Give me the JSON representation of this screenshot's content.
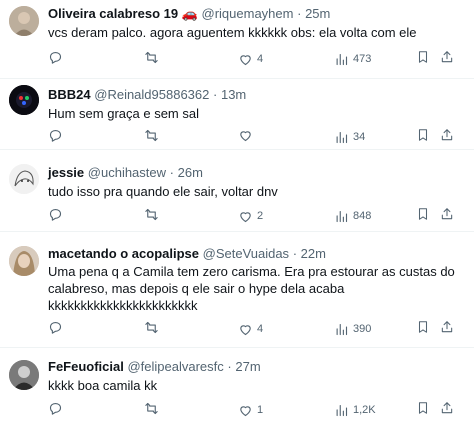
{
  "tweets": [
    {
      "name": "Oliveira calabreso 19 🚗",
      "handle": "@riquemayhem",
      "sep": "·",
      "time": "25m",
      "text": [
        "vcs deram palco. agora aguentem kkkkkk obs: ela volta com ele"
      ],
      "replies": "",
      "retweets": "",
      "likes": "4",
      "views": "473"
    },
    {
      "name": "BBB24",
      "handle": "@Reinald95886362",
      "sep": "·",
      "time": "13m",
      "text": [
        "Hum sem graça e sem sal"
      ],
      "replies": "",
      "retweets": "",
      "likes": "",
      "views": "34"
    },
    {
      "name": "jessie",
      "handle": "@uchihastew",
      "sep": "·",
      "time": "26m",
      "text": [
        "tudo isso pra quando ele sair, voltar dnv"
      ],
      "replies": "",
      "retweets": "",
      "likes": "2",
      "views": "848"
    },
    {
      "name": "macetando o acopalipse",
      "handle": "@SeteVuaidas",
      "sep": "·",
      "time": "22m",
      "text": [
        "Uma pena q a Camila tem zero carisma. Era pra estourar as custas do",
        "calabreso, mas depois q ele sair o hype dela acaba",
        "kkkkkkkkkkkkkkkkkkkkkkk"
      ],
      "replies": "",
      "retweets": "",
      "likes": "4",
      "views": "390"
    },
    {
      "name": "FeFeuoficial",
      "handle": "@felipealvaresfc",
      "sep": "·",
      "time": "27m",
      "text": [
        "kkkk boa camila kk"
      ],
      "replies": "",
      "retweets": "",
      "likes": "1",
      "views": "1,2K"
    }
  ],
  "colors": {
    "text": "#0f1419",
    "secondary": "#536471",
    "divider": "#eff3f4"
  },
  "icons": {
    "reply": "reply-icon",
    "retweet": "retweet-icon",
    "like": "heart-icon",
    "views": "views-icon",
    "bookmark": "bookmark-icon",
    "share": "share-icon"
  }
}
